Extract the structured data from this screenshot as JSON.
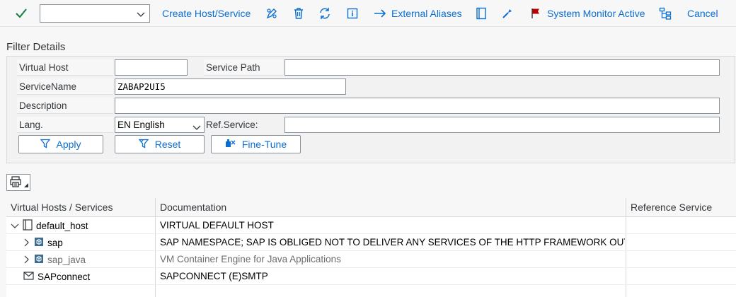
{
  "toolbar": {
    "combo_value": "",
    "create_label": "Create Host/Service",
    "external_aliases_label": "External Aliases",
    "system_monitor_label": "System Monitor Active",
    "cancel_label": "Cancel",
    "accent": "#0a6ed1",
    "confirm_color": "#107e3e",
    "flag_color": "#bb0000"
  },
  "filter": {
    "title": "Filter Details",
    "virtual_host_label": "Virtual Host",
    "virtual_host_value": "",
    "service_path_label": "Service Path",
    "service_path_value": "",
    "service_name_label": "ServiceName",
    "service_name_value": "ZABAP2UI5",
    "description_label": "Description",
    "description_value": "",
    "lang_label": "Lang.",
    "lang_value": "EN English",
    "ref_service_label": "Ref.Service:",
    "ref_service_value": "",
    "apply_label": "Apply",
    "reset_label": "Reset",
    "fine_tune_label": "Fine-Tune"
  },
  "tree": {
    "columns": [
      "Virtual Hosts / Services",
      "Documentation",
      "Reference Service"
    ],
    "rows": [
      {
        "name": "default_host",
        "doc": "VIRTUAL DEFAULT HOST",
        "ref": "",
        "icon": "host-icon",
        "expanded": true
      },
      {
        "name": "sap",
        "doc": "SAP NAMESPACE; SAP IS OBLIGED NOT TO DELIVER ANY SERVICES OF THE HTTP FRAMEWORK OUT",
        "ref": "",
        "icon": "package-icon",
        "expanded": false
      },
      {
        "name": "sap_java",
        "doc": "VM Container Engine for Java Applications",
        "ref": "",
        "icon": "package-icon",
        "expanded": false
      },
      {
        "name": "SAPconnect",
        "doc": "SAPCONNECT (E)SMTP",
        "ref": "",
        "icon": "envelope-icon",
        "expanded": false
      }
    ]
  }
}
